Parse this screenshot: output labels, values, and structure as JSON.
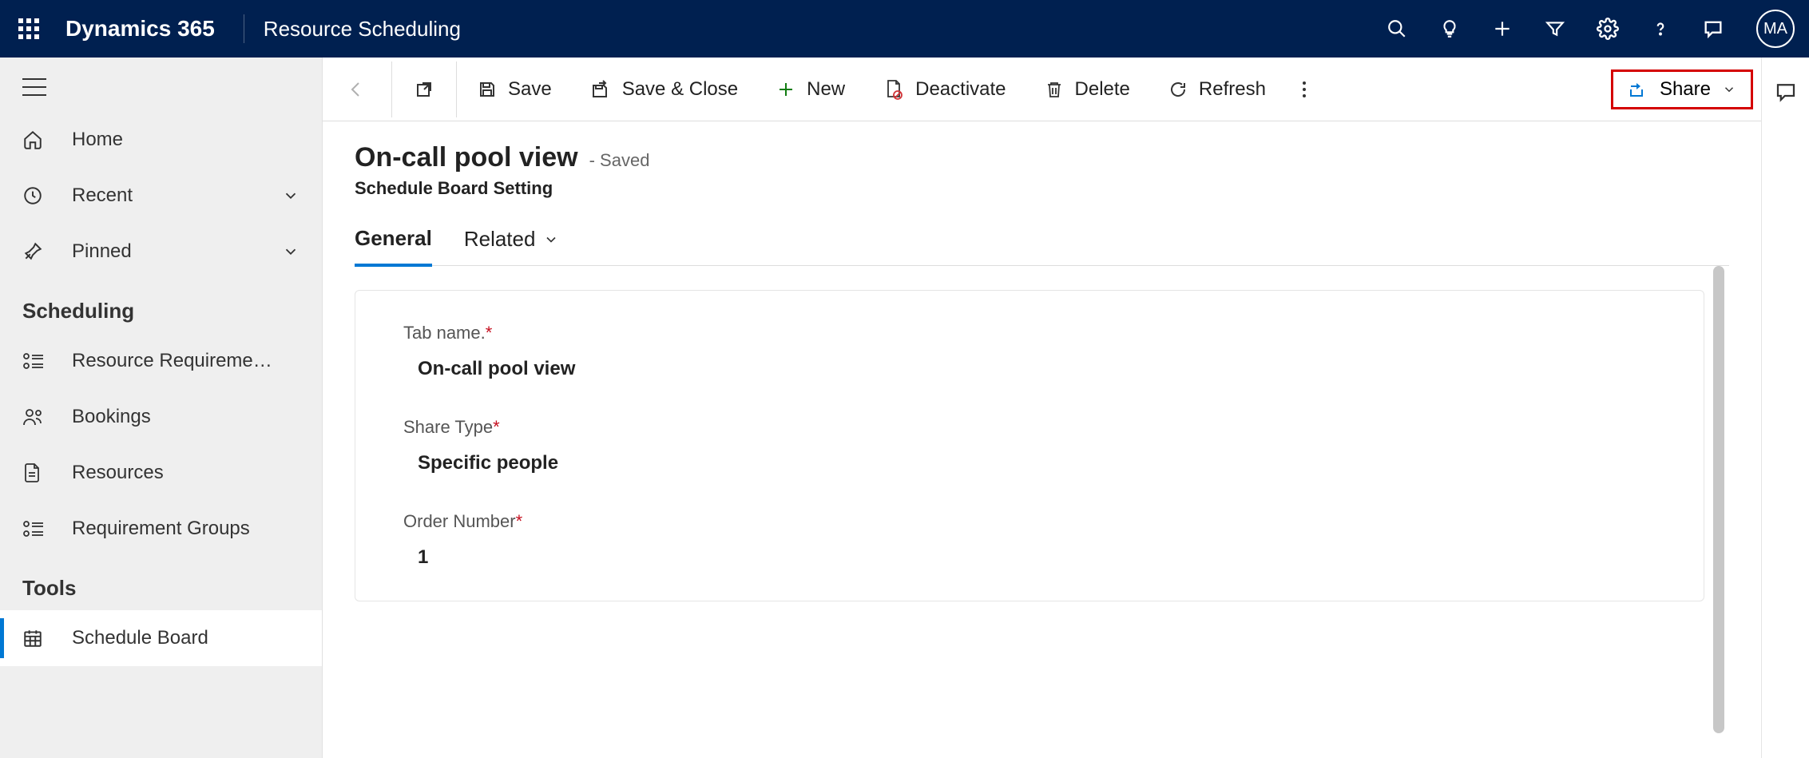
{
  "header": {
    "brand": "Dynamics 365",
    "app": "Resource Scheduling",
    "avatar": "MA"
  },
  "sidebar": {
    "home": "Home",
    "recent": "Recent",
    "pinned": "Pinned",
    "section_scheduling": "Scheduling",
    "resource_requirements": "Resource Requireme…",
    "bookings": "Bookings",
    "resources": "Resources",
    "requirement_groups": "Requirement Groups",
    "section_tools": "Tools",
    "schedule_board": "Schedule Board"
  },
  "cmdbar": {
    "save": "Save",
    "save_close": "Save & Close",
    "new": "New",
    "deactivate": "Deactivate",
    "delete": "Delete",
    "refresh": "Refresh",
    "share": "Share"
  },
  "record": {
    "title": "On-call pool view",
    "status": "- Saved",
    "subtitle": "Schedule Board Setting"
  },
  "tabs": {
    "general": "General",
    "related": "Related"
  },
  "form": {
    "tab_name_label": "Tab name.",
    "tab_name_value": "On-call pool view",
    "share_type_label": "Share Type",
    "share_type_value": "Specific people",
    "order_number_label": "Order Number",
    "order_number_value": "1"
  }
}
